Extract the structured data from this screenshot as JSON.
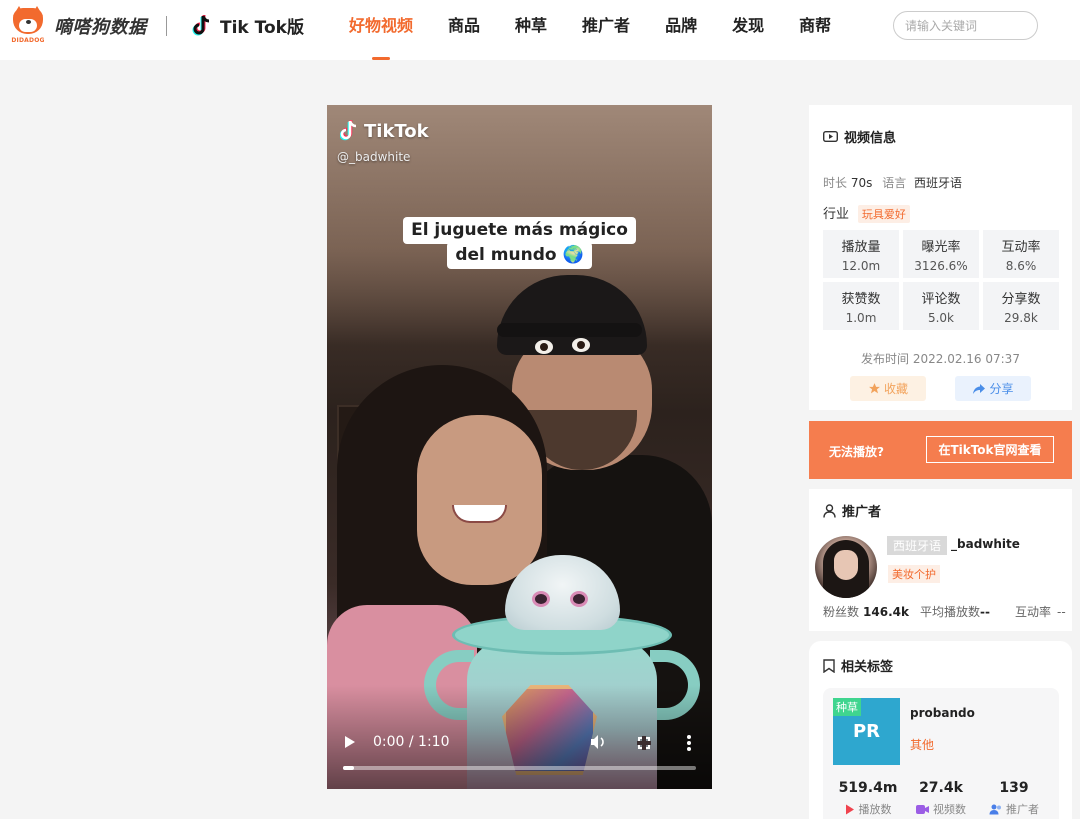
{
  "brand": {
    "logo_subtext": "DIDADOG",
    "name": "嘀嗒狗数据",
    "product": "Tik Tok版"
  },
  "nav": {
    "items": [
      {
        "label": "好物视频",
        "active": true
      },
      {
        "label": "商品",
        "active": false
      },
      {
        "label": "种草",
        "active": false
      },
      {
        "label": "推广者",
        "active": false
      },
      {
        "label": "品牌",
        "active": false
      },
      {
        "label": "发现",
        "active": false
      },
      {
        "label": "商帮",
        "active": false
      }
    ]
  },
  "search": {
    "placeholder": "请输入关键词"
  },
  "video": {
    "watermark": "TikTok",
    "handle": "@_badwhite",
    "caption_line1": "El juguete más mágico",
    "caption_line2": "del mundo 🌍",
    "time": "0:00 / 1:10",
    "progress": 0.03
  },
  "video_info": {
    "title": "视频信息",
    "duration_label": "时长",
    "duration": "70s",
    "language_label": "语言",
    "language": "西班牙语",
    "industry_label": "行业",
    "industry": "玩具爱好",
    "stats": [
      {
        "label": "播放量",
        "value": "12.0m"
      },
      {
        "label": "曝光率",
        "value": "3126.6%"
      },
      {
        "label": "互动率",
        "value": "8.6%"
      },
      {
        "label": "获赞数",
        "value": "1.0m"
      },
      {
        "label": "评论数",
        "value": "5.0k"
      },
      {
        "label": "分享数",
        "value": "29.8k"
      }
    ],
    "publish_time": "发布时间 2022.02.16 07:37",
    "favorite_label": "收藏",
    "share_label": "分享"
  },
  "cta": {
    "text": "无法播放?",
    "button": "在TikTok官网查看"
  },
  "promoter": {
    "title": "推广者",
    "language_tag": "西班牙语",
    "name": "_badwhite",
    "category": "美妆个护",
    "fans_label": "粉丝数",
    "fans": "146.4k",
    "avg_play_label": "平均播放数",
    "avg_play": "--",
    "interaction_label": "互动率",
    "interaction": "--"
  },
  "tags": {
    "title": "相关标签",
    "card": {
      "badge": "种草",
      "abbr": "PR",
      "name": "probando",
      "category": "其他",
      "plays": "519.4m",
      "plays_label": "播放数",
      "videos": "27.4k",
      "videos_label": "视频数",
      "promoters": "139",
      "promoters_label": "推广者"
    }
  },
  "colors": {
    "accent": "#f26a2e",
    "cta_bg": "#f57d4e",
    "tag_bg": "#2ea7cf",
    "badge_green": "#3fd58f"
  }
}
